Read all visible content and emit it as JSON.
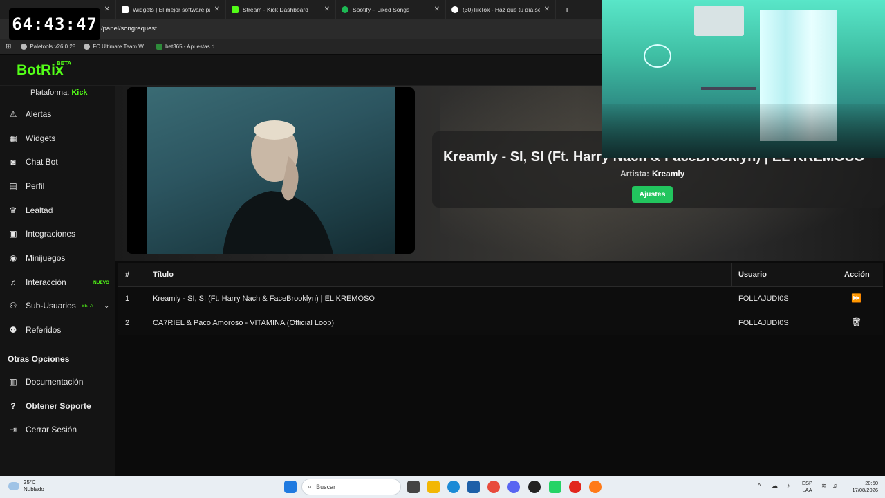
{
  "browser": {
    "tabs": [
      {
        "title": "",
        "color": "#53fc18"
      },
      {
        "title": "Widgets | El mejor software para",
        "color": "#ffffff"
      },
      {
        "title": "Stream - Kick Dashboard",
        "color": "#53fc18"
      },
      {
        "title": "Spotify – Liked Songs",
        "color": "#1db954"
      },
      {
        "title": "(30)TikTok - Haz que tu día sea",
        "color": "#ffffff"
      }
    ],
    "new_tab": "+",
    "close_glyph": "✕",
    "url": "/panel/songrequest",
    "bookmarks": [
      "Paletools v26.0.28",
      "FC Ultimate Team W...",
      "bet365 - Apuestas d..."
    ]
  },
  "overlay": {
    "timer": "64:43:47"
  },
  "app": {
    "logo": "BotRix",
    "beta": "BETA",
    "accent": "#53fc18"
  },
  "sidebar": {
    "platform_label": "Plataforma:",
    "platform_value": "Kick",
    "items": [
      {
        "label": "Alertas",
        "icon": "warning-icon"
      },
      {
        "label": "Widgets",
        "icon": "grid-icon"
      },
      {
        "label": "Chat Bot",
        "icon": "robot-icon"
      },
      {
        "label": "Perfil",
        "icon": "id-card-icon"
      },
      {
        "label": "Lealtad",
        "icon": "trophy-icon"
      },
      {
        "label": "Integraciones",
        "icon": "plug-icon"
      },
      {
        "label": "Minijuegos",
        "icon": "gamepad-icon"
      },
      {
        "label": "Interacción",
        "icon": "music-icon",
        "badge": "NUEVO"
      },
      {
        "label": "Sub-Usuarios",
        "icon": "users-icon",
        "badge": "BETA"
      },
      {
        "label": "Referidos",
        "icon": "user-group-icon"
      }
    ],
    "section_title": "Otras Opciones",
    "other_items": [
      {
        "label": "Documentación",
        "icon": "book-icon"
      },
      {
        "label": "Obtener Soporte",
        "icon": "question-icon"
      },
      {
        "label": "Cerrar Sesión",
        "icon": "logout-icon"
      }
    ]
  },
  "player": {
    "title": "Kreamly - SI, SI (Ft. Harry Nach & FaceBrooklyn) | EL KREMOSO",
    "artist_label": "Artista:",
    "artist": "Kreamly",
    "settings_button": "Ajustes",
    "button_color": "#22c55e"
  },
  "queue": {
    "headers": {
      "num": "#",
      "title": "Título",
      "user": "Usuario",
      "action": "Acción"
    },
    "rows": [
      {
        "num": "1",
        "title": "Kreamly - SI, SI (Ft. Harry Nach & FaceBrooklyn) | EL KREMOSO",
        "user": "FOLLAJUDI0S",
        "action_icon": "skip-forward-icon",
        "action_glyph": "⏩"
      },
      {
        "num": "2",
        "title": "CA7RIEL & Paco Amoroso - VITAMINA (Official Loop)",
        "user": "FOLLAJUDI0S",
        "action_icon": "trash-icon",
        "action_glyph": "🗑"
      }
    ]
  },
  "taskbar": {
    "temperature": "25°C",
    "weather": "Nublado",
    "search_placeholder": "Buscar",
    "lang_top": "ESP",
    "lang_bottom": "LAA",
    "time": "20:50",
    "date": "17/08/2026"
  }
}
